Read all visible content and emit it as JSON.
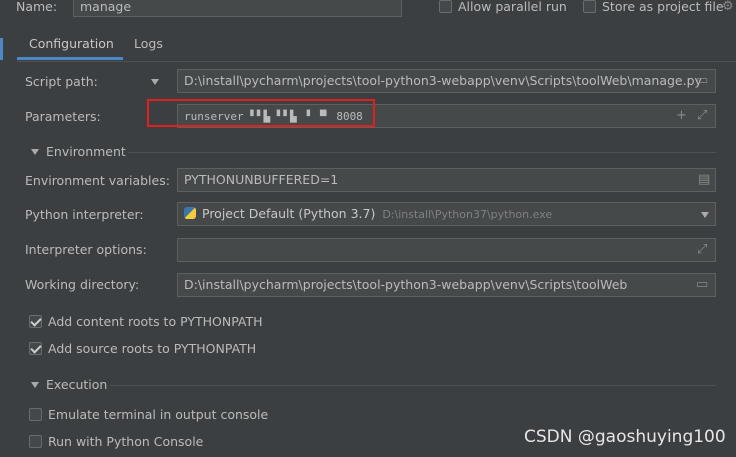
{
  "header": {
    "name_label": "Name:",
    "name_value": "manage",
    "allow_parallel_label": "Allow parallel run",
    "store_project_label": "Store as project file"
  },
  "tabs": [
    {
      "label": "Configuration",
      "active": true
    },
    {
      "label": "Logs",
      "active": false
    }
  ],
  "config": {
    "script_path_label": "Script path:",
    "script_path_value": "D:\\install\\pycharm\\projects\\tool-python3-webapp\\venv\\Scripts\\toolWeb\\manage.py",
    "parameters_label": "Parameters:",
    "parameters_value": "runserver ▘▘▙ ▘▘▙ ▝ ▝▘ 8008",
    "environment_section": "Environment",
    "env_vars_label": "Environment variables:",
    "env_vars_value": "PYTHONUNBUFFERED=1",
    "interpreter_label": "Python interpreter:",
    "interpreter_value": "Project Default (Python 3.7)",
    "interpreter_path": "D:\\install\\Python37\\python.exe",
    "interpreter_options_label": "Interpreter options:",
    "interpreter_options_value": "",
    "working_dir_label": "Working directory:",
    "working_dir_value": "D:\\install\\pycharm\\projects\\tool-python3-webapp\\venv\\Scripts\\toolWeb",
    "add_content_roots_label": "Add content roots to PYTHONPATH",
    "add_source_roots_label": "Add source roots to PYTHONPATH",
    "execution_section": "Execution",
    "emulate_terminal_label": "Emulate terminal in output console",
    "run_python_console_label": "Run with Python Console"
  },
  "watermark": "CSDN @gaoshuying100",
  "colors": {
    "background": "#3c3f41",
    "highlight_box": "#e0201e",
    "tab_underline": "#4a88c7"
  }
}
